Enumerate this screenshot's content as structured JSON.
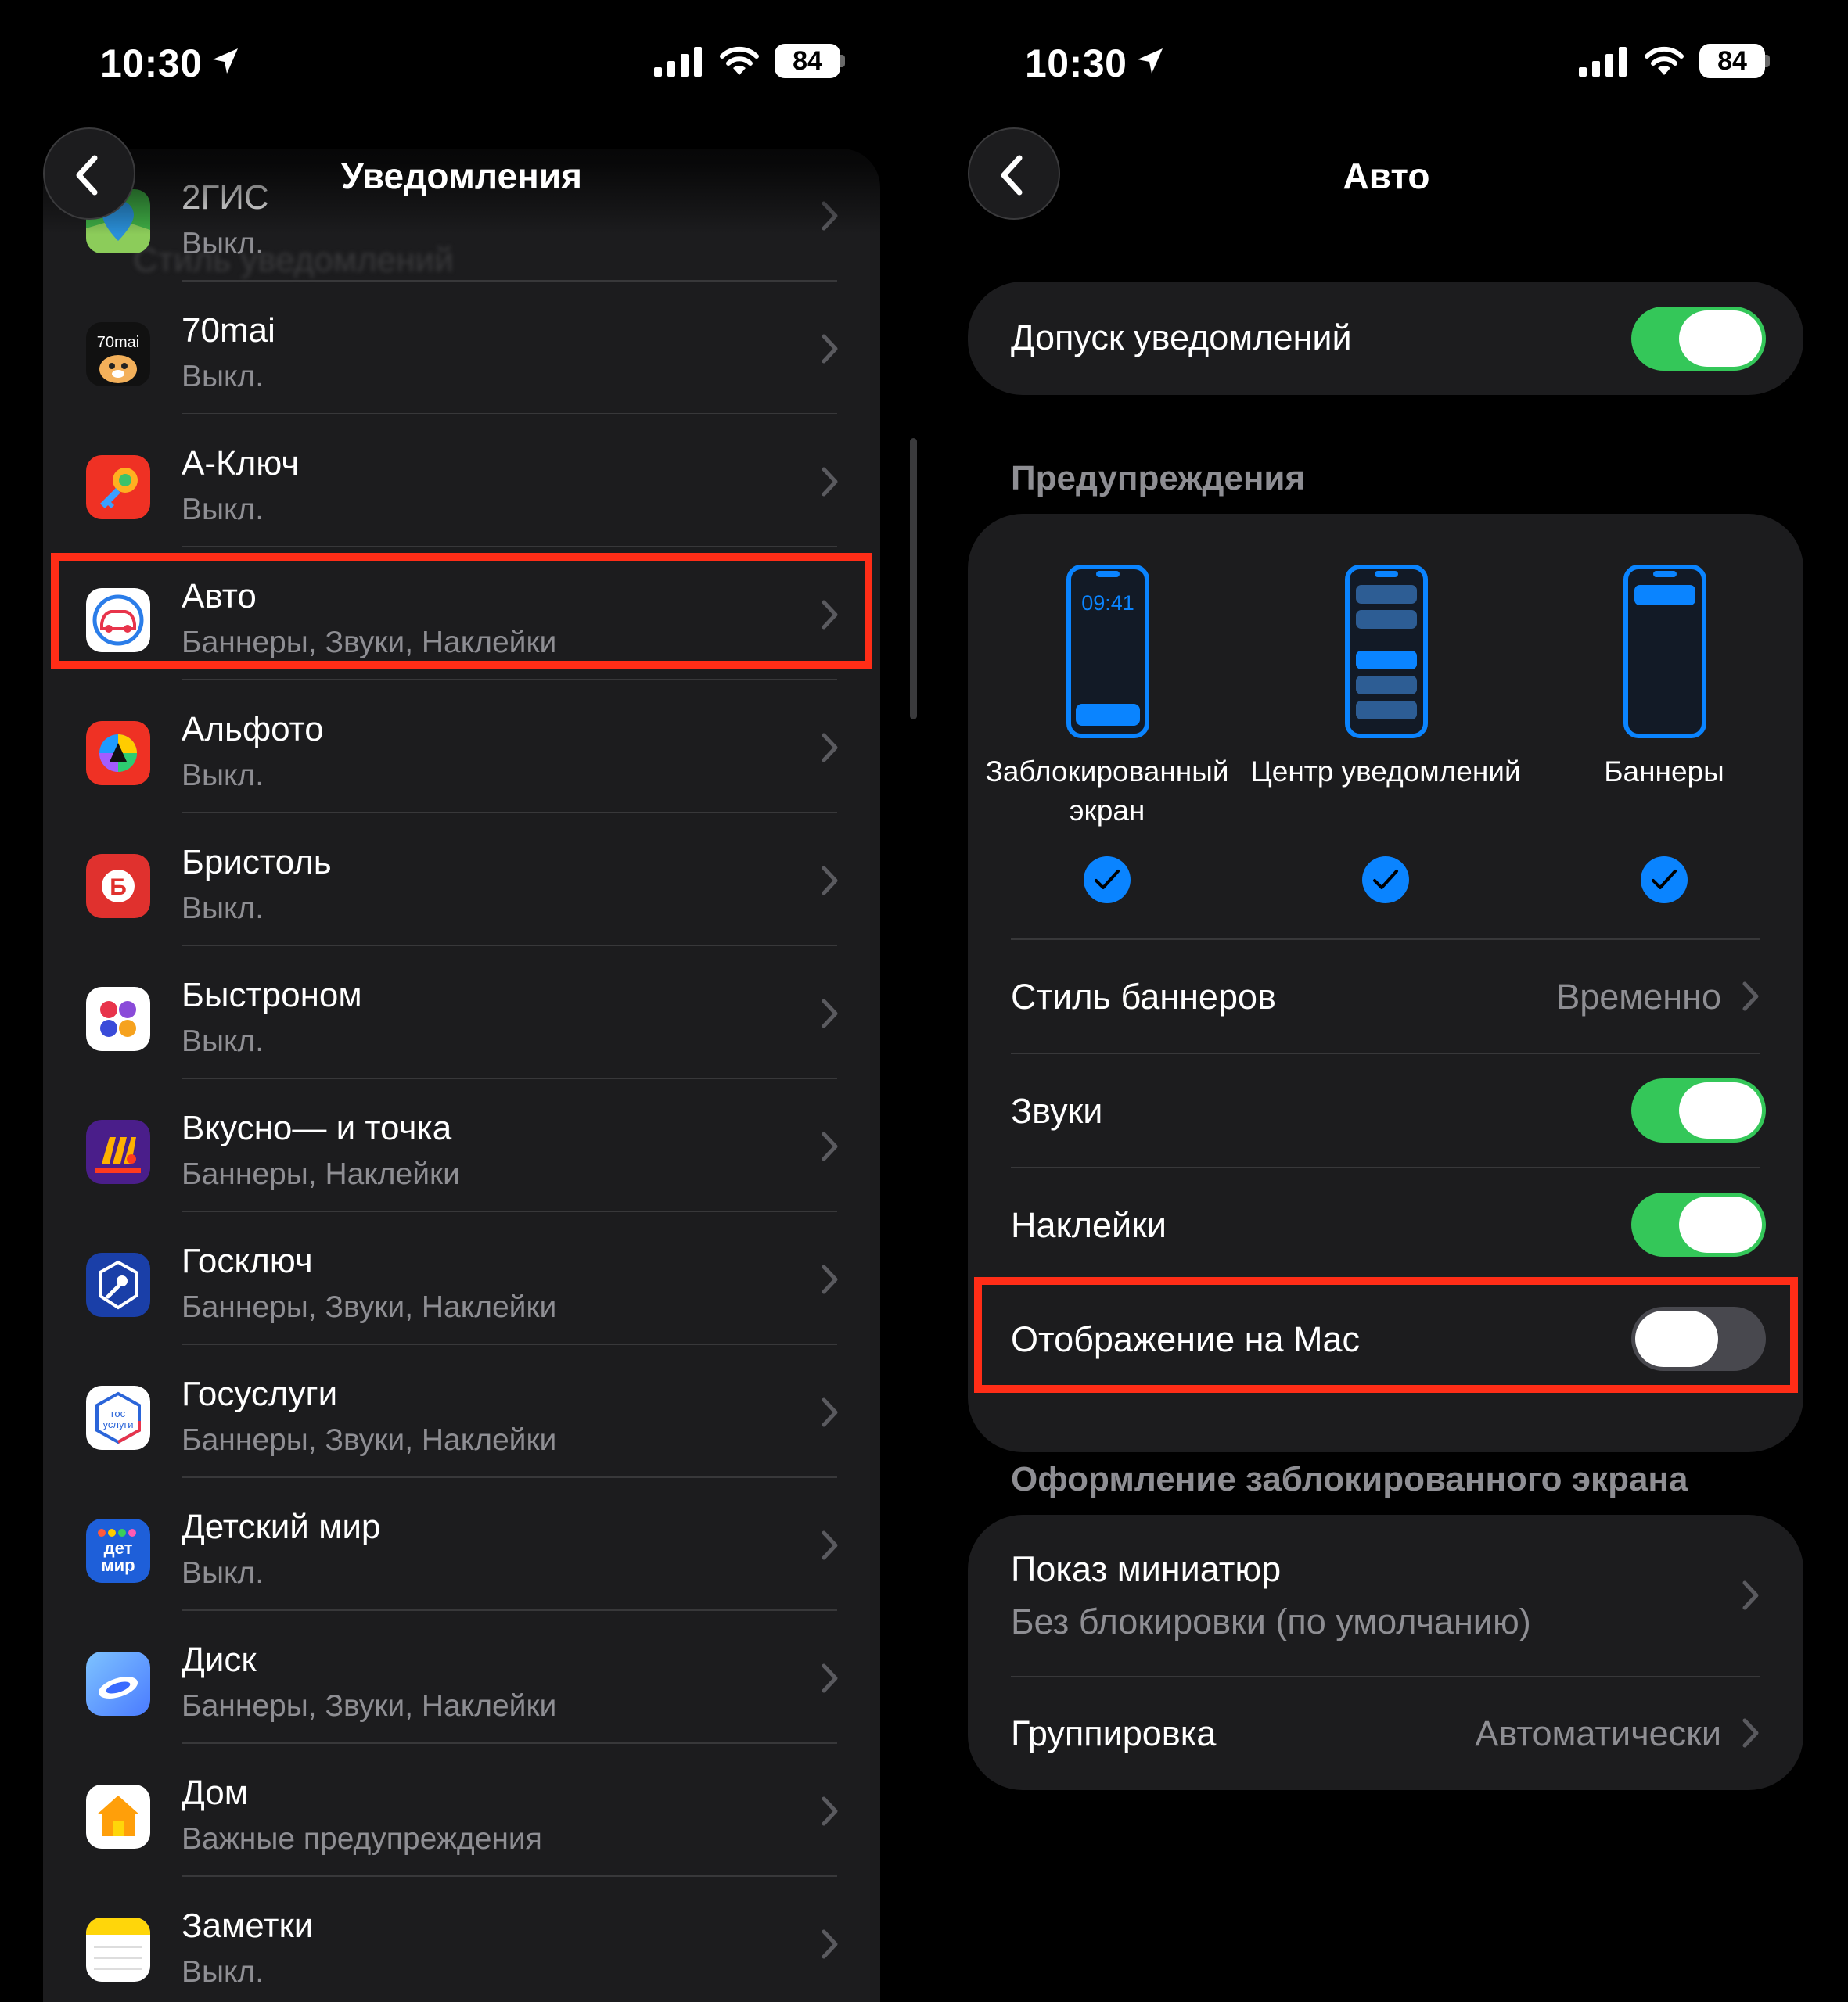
{
  "status_bar": {
    "time": "10:30",
    "battery": "84"
  },
  "left": {
    "nav_title": "Уведомления",
    "ghost_header": "Стиль уведомлений",
    "apps": [
      {
        "name": "2ГИС",
        "status": "Выкл."
      },
      {
        "name": "70mai",
        "status": "Выкл."
      },
      {
        "name": "А-Ключ",
        "status": "Выкл."
      },
      {
        "name": "Авто",
        "status": "Баннеры, Звуки, Наклейки"
      },
      {
        "name": "Альфото",
        "status": "Выкл."
      },
      {
        "name": "Бристоль",
        "status": "Выкл."
      },
      {
        "name": "Быстроном",
        "status": "Выкл."
      },
      {
        "name": "Вкусно— и точка",
        "status": "Баннеры, Наклейки"
      },
      {
        "name": "Госключ",
        "status": "Баннеры, Звуки, Наклейки"
      },
      {
        "name": "Госуслуги",
        "status": "Баннеры, Звуки, Наклейки"
      },
      {
        "name": "Детский мир",
        "status": "Выкл."
      },
      {
        "name": "Диск",
        "status": "Баннеры, Звуки, Наклейки"
      },
      {
        "name": "Дом",
        "status": "Важные предупреждения"
      },
      {
        "name": "Заметки",
        "status": "Выкл."
      }
    ],
    "icon_texts": {
      "seventy_mai": "70mai",
      "bristol": "Б",
      "gos_top": "гос",
      "gos_bottom": "услуги",
      "det_top": "дет",
      "det_bottom": "мир"
    }
  },
  "right": {
    "nav_title": "Авто",
    "allow_notifications": {
      "label": "Допуск уведомлений",
      "on": true
    },
    "alerts_header": "Предупреждения",
    "alert_options": [
      {
        "label_line1": "Заблокированный",
        "label_line2": "экран",
        "checked": true,
        "preview_time": "09:41"
      },
      {
        "label_line1": "Центр уведомлений",
        "label_line2": "",
        "checked": true
      },
      {
        "label_line1": "Баннеры",
        "label_line2": "",
        "checked": true
      }
    ],
    "banner_style": {
      "label": "Стиль баннеров",
      "value": "Временно"
    },
    "sounds": {
      "label": "Звуки",
      "on": true
    },
    "badges": {
      "label": "Наклейки",
      "on": true
    },
    "show_on_mac": {
      "label": "Отображение на Mac",
      "on": false
    },
    "lock_screen_header": "Оформление заблокированного экрана",
    "show_previews": {
      "label": "Показ миниатюр",
      "value": "Без блокировки (по умолчанию)"
    },
    "grouping": {
      "label": "Группировка",
      "value": "Автоматически"
    }
  },
  "colors": {
    "accent": "#0a84ff",
    "toggle_on": "#34c759",
    "highlight": "#ff2d17",
    "cell_bg": "#1c1c1e"
  }
}
